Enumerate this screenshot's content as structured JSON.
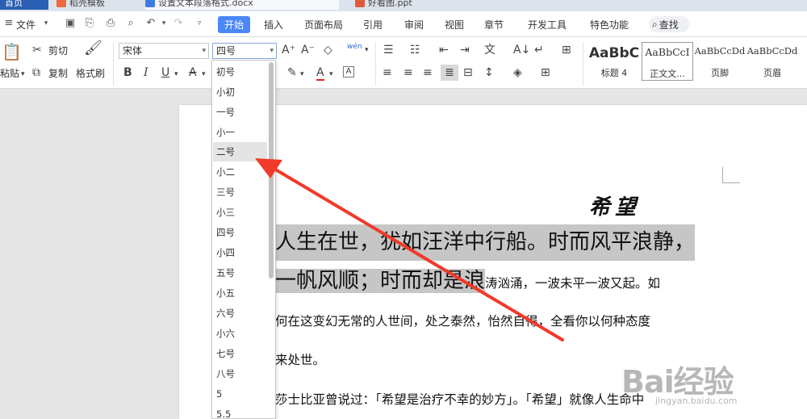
{
  "titlebar": {
    "tabs": [
      {
        "label": "首页"
      },
      {
        "label": "稻壳模板"
      },
      {
        "label": "设置文本段落格式.docx"
      },
      {
        "label": "好看图.ppt"
      }
    ]
  },
  "menubar": {
    "file": "文件",
    "tabs": [
      "开始",
      "插入",
      "页面布局",
      "引用",
      "审阅",
      "视图",
      "章节",
      "开发工具",
      "特色功能"
    ],
    "search": "查找"
  },
  "ribbon": {
    "paste": "粘贴",
    "cut": "剪切",
    "copy": "复制",
    "format_painter": "格式刷",
    "font_name": "宋体",
    "font_size": "四号",
    "phonetic": "wén",
    "styles": [
      {
        "sample": "AaBbC",
        "name": "标题 4"
      },
      {
        "sample": "AaBbCcI",
        "name": "正文文..."
      },
      {
        "sample": "AaBbCcDd",
        "name": "页脚"
      },
      {
        "sample": "AaBbCcDd",
        "name": "页眉"
      }
    ]
  },
  "font_size_dropdown": {
    "options": [
      "初号",
      "小初",
      "一号",
      "小一",
      "二号",
      "小二",
      "三号",
      "小三",
      "四号",
      "小四",
      "五号",
      "小五",
      "六号",
      "小六",
      "七号",
      "八号",
      "5",
      "5.5"
    ],
    "selected": "二号"
  },
  "document": {
    "title": "希望",
    "line1": "人生在世，犹如汪洋中行船。时而风平浪静，",
    "line2_highlight": "一帆风顺；时而却是浪",
    "line2_rest": "涛汹涌，一波未平一波又起。如",
    "line3": "何在这变幻无常的人世间，处之泰然，怡然自得，全看你以何种态度",
    "line4": "来处世。",
    "line5": "莎士比亚曾说过：「希望是治疗不幸的妙方」。「希望」就像人生命中"
  },
  "watermark": {
    "text": "Bai经验",
    "sub": "jingyan.baidu.com"
  },
  "colors": {
    "accent": "#4a87f7",
    "arrow": "#f03a2a",
    "highlight": "#c6c6c6"
  }
}
